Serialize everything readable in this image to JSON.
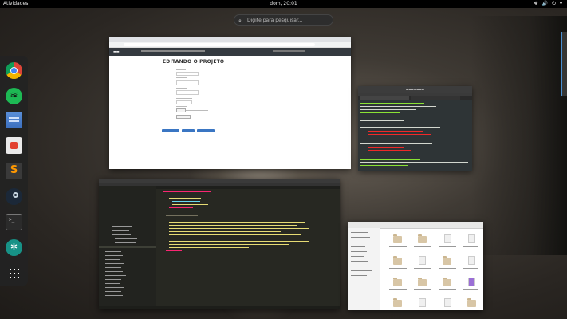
{
  "topbar": {
    "activities": "Atividades",
    "clock": "dom, 20:01",
    "tray": [
      "❖",
      "🔊",
      "⏻",
      "▾"
    ]
  },
  "search": {
    "icon": "search-icon",
    "placeholder": "Digite para pesquisar..."
  },
  "dash": {
    "apps": [
      "chrome-icon",
      "spotify-icon",
      "files-icon",
      "software-store-icon",
      "sublime-text-icon",
      "steam-icon",
      "terminal-icon",
      "gitkraken-icon",
      "show-applications-icon"
    ]
  },
  "browser_window": {
    "page_title": "EDITANDO O PROJETO"
  },
  "colors": {
    "accent": "#3a76c3",
    "topbar": "#000000",
    "dash": "#232323"
  }
}
